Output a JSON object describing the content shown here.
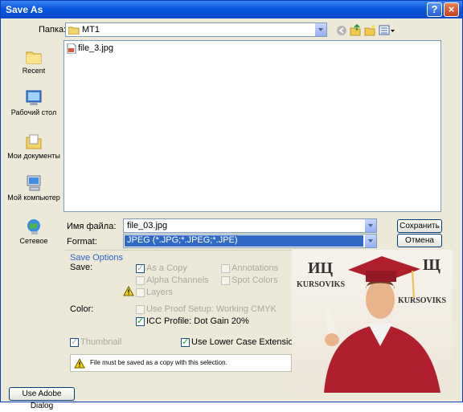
{
  "window": {
    "title": "Save As",
    "help_glyph": "?",
    "close_glyph": "×"
  },
  "folder": {
    "label": "Папка:",
    "value": "MT1"
  },
  "places": [
    {
      "label": "Recent",
      "icon": "recent-folder-icon"
    },
    {
      "label": "Рабочий стол",
      "icon": "desktop-icon"
    },
    {
      "label": "Мои документы",
      "icon": "my-documents-icon"
    },
    {
      "label": "Мой компьютер",
      "icon": "my-computer-icon"
    },
    {
      "label": "Сетевое",
      "icon": "network-icon"
    }
  ],
  "files": [
    {
      "name": "file_3.jpg",
      "icon": "jpg-file-icon"
    }
  ],
  "filename": {
    "label": "Имя файла:",
    "value": "file_03.jpg"
  },
  "format": {
    "label": "Format:",
    "value": "JPEG (*.JPG;*.JPEG;*.JPE)"
  },
  "buttons": {
    "save": "Сохранить",
    "cancel": "Отмена",
    "adobe": "Use Adobe Dialog"
  },
  "save_options": {
    "title": "Save Options",
    "save_label": "Save:",
    "as_copy": "As a Copy",
    "annotations": "Annotations",
    "alpha": "Alpha Channels",
    "spot": "Spot Colors",
    "layers": "Layers",
    "color_label": "Color:",
    "proof": "Use Proof Setup:  Working CMYK",
    "icc": "ICC Profile:  Dot Gain 20%",
    "thumbnail": "Thumbnail",
    "lowercase": "Use Lower Case Extension",
    "warning": "File must be saved as a copy with this selection."
  },
  "watermark": {
    "left_top": "ИЦ",
    "left_bottom": "KURSOVIKS",
    "right_top": "Щ",
    "right_bottom": "KURSOVIKS"
  },
  "colors": {
    "titlebar": "#0a58e0",
    "selection": "#316ac5",
    "accent_gown": "#b0202c"
  }
}
